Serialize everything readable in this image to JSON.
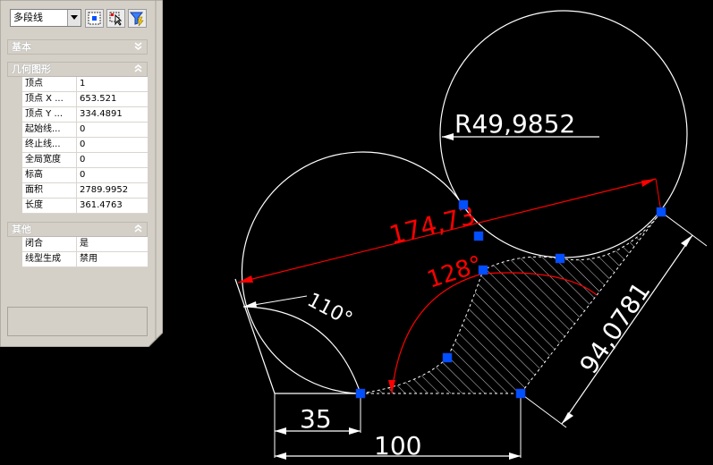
{
  "toolbar": {
    "object_type": "多段线",
    "buttons": [
      "quick-select-icon",
      "select-objects-icon",
      "toggle-pickadd-icon"
    ]
  },
  "sections": {
    "basic": {
      "title": "基本",
      "state": "collapsed"
    },
    "geometry": {
      "title": "几何图形",
      "state": "expanded",
      "rows": [
        {
          "key": "顶点",
          "value": "1"
        },
        {
          "key": "顶点 X ...",
          "value": "653.521"
        },
        {
          "key": "顶点 Y ...",
          "value": "334.4891"
        },
        {
          "key": "起始线...",
          "value": "0"
        },
        {
          "key": "终止线...",
          "value": "0"
        },
        {
          "key": "全局宽度",
          "value": "0"
        },
        {
          "key": "标高",
          "value": "0"
        },
        {
          "key": "面积",
          "value": "2789.9952"
        },
        {
          "key": "长度",
          "value": "361.4763"
        }
      ]
    },
    "misc": {
      "title": "其他",
      "state": "expanded",
      "rows": [
        {
          "key": "闭合",
          "value": "是"
        },
        {
          "key": "线型生成",
          "value": "禁用"
        }
      ]
    }
  },
  "drawing": {
    "dimensions": {
      "radius": "R49,9852",
      "aligned_top": "174,73",
      "arc_angle": "128°",
      "angle": "110°",
      "width_small": "35",
      "width_large": "100",
      "side": "94,0781"
    },
    "colors": {
      "geometry": "#ffffff",
      "dimension_red": "#ff0000",
      "grip": "#0050ff",
      "panel": "#d4d0c8"
    }
  }
}
